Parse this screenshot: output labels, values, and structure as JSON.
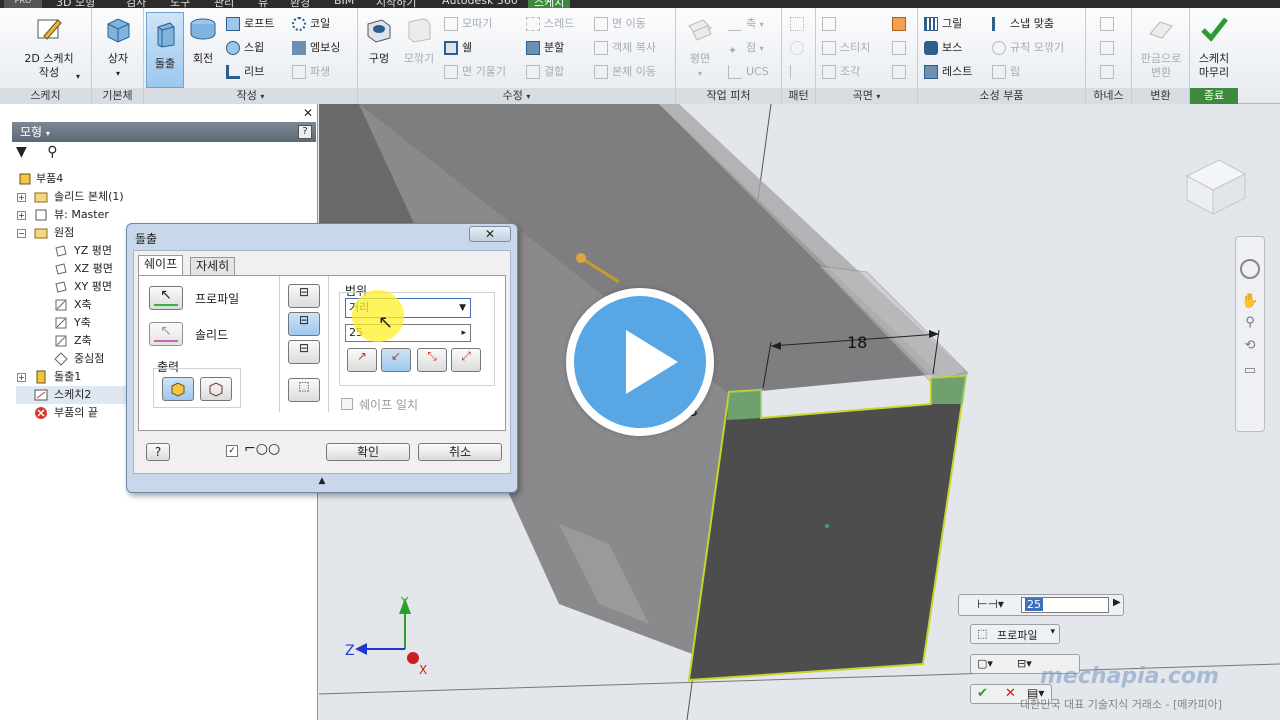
{
  "tabs": {
    "pro": "PRO",
    "items": [
      "3D 모형",
      "검사",
      "도구",
      "관리",
      "뷰",
      "환경",
      "BIM",
      "시작하기",
      "Autodesk 360",
      "스케치"
    ]
  },
  "ribbon": {
    "groups": {
      "sketch": "스케치",
      "primitives": "기본체",
      "create": "작성",
      "modify": "수정",
      "work_features": "작업 피처",
      "pattern": "패턴",
      "surface": "곡면",
      "plastic_part": "소성 부품",
      "harness": "하네스",
      "convert": "변환",
      "exit": "종료"
    },
    "sketch_btn": "2D 스케치\n작성",
    "box_btn": "상자",
    "extrude_btn": "돌출",
    "revolve_btn": "회전",
    "loft": "로프트",
    "sweep": "스윕",
    "rib": "리브",
    "coil": "코일",
    "emboss": "엠보싱",
    "derive": "파생",
    "hole": "구멍",
    "fillet": "모깎기",
    "chamfer": "모따기",
    "shell": "쉘",
    "face_draft": "면 기울기",
    "thread": "스레드",
    "split": "분할",
    "combine": "결합",
    "delete_face": "면 이동",
    "copy_object": "객체 복사",
    "move_bodies": "본체 이동",
    "plane": "평면",
    "axis": "축",
    "point": "점",
    "ucs": "UCS",
    "stitch": "스티치",
    "sculpt": "조각",
    "grill": "그릴",
    "boss": "보스",
    "rest": "레스트",
    "snap_fit": "스냅 맞춤",
    "rule_fillet": "규칙 모깎기",
    "lip": "립",
    "convert_sheet": "판금으로\n변환",
    "finish_sketch": "스케치\n마무리"
  },
  "browser": {
    "header": "모형",
    "tree": [
      {
        "label": "부품4",
        "level": 0
      },
      {
        "label": "솔리드 본체(1)",
        "level": 1
      },
      {
        "label": "뷰: Master",
        "level": 1
      },
      {
        "label": "원점",
        "level": 1
      },
      {
        "label": "YZ 평면",
        "level": 2
      },
      {
        "label": "XZ 평면",
        "level": 2
      },
      {
        "label": "XY 평면",
        "level": 2
      },
      {
        "label": "X축",
        "level": 2
      },
      {
        "label": "Y축",
        "level": 2
      },
      {
        "label": "Z축",
        "level": 2
      },
      {
        "label": "중심점",
        "level": 2
      },
      {
        "label": "돌출1",
        "level": 1
      },
      {
        "label": "스케치2",
        "level": 1
      },
      {
        "label": "부품의 끝",
        "level": 1
      }
    ]
  },
  "dialog": {
    "title": "돌출",
    "tab_shape": "쉐이프",
    "tab_more": "자세히",
    "profile": "프로파일",
    "solid": "솔리드",
    "output": "출력",
    "extents": "범위",
    "extent_type": "거리",
    "distance": "25",
    "match_shape": "쉐이프 일치",
    "ok": "확인",
    "cancel": "취소"
  },
  "viewport": {
    "dim_18": "18",
    "dim_3": "3",
    "axis_x": "X",
    "axis_y": "Y",
    "axis_z": "Z"
  },
  "minitoolbar": {
    "value": "25",
    "profile": "프로파일"
  },
  "watermark": {
    "brand": "mechapia.com",
    "tagline": "대한민국 대표 기술지식 거래소 - [메카피아]"
  },
  "colors": {
    "accent": "#58a6e3",
    "selected_edge": "#c8d42c",
    "part_face": "#4d4d4d",
    "sketch_green": "#7cc47c"
  }
}
